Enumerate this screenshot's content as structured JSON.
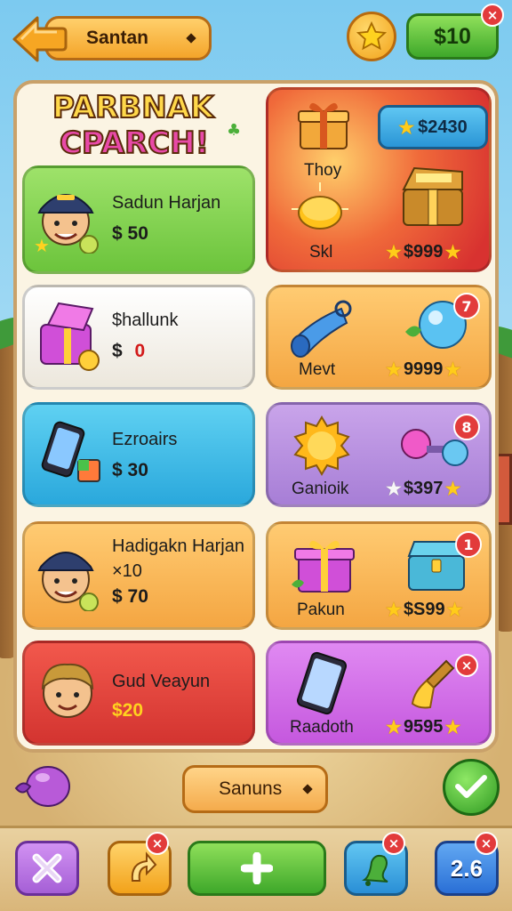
{
  "header": {
    "title": "Santan",
    "cash": "$10",
    "cash_badge": "×"
  },
  "logo": {
    "line1": "PARBNAK",
    "line2": "CPARCH!"
  },
  "players": [
    {
      "name": "Sadun Harjan",
      "price": "$ 50"
    },
    {
      "name": "$hallunk",
      "price": "$ 0",
      "price_prefix": "$",
      "price_value": "0"
    },
    {
      "name": "Ezroairs",
      "price": "$ 30"
    },
    {
      "name": "Hadigakn Harjan",
      "sub": "×10",
      "price": "$ 70"
    },
    {
      "name": "Gud Veayun",
      "price": "$20"
    }
  ],
  "featured": {
    "balance": "$2430",
    "label_top": "Thoy",
    "label_bottom": "Skl",
    "price": "$999"
  },
  "items": [
    {
      "label": "Mevt",
      "price": "9999",
      "badge": "7"
    },
    {
      "label": "Ganioik",
      "price": "$397",
      "badge": "8"
    },
    {
      "label": "Pakun",
      "price": "$S99",
      "badge": "1"
    },
    {
      "label": "Raadoth",
      "price": "9595",
      "badge": "×"
    }
  ],
  "bottom": {
    "center_button": "Sanuns",
    "level": "2.6",
    "arrow_badge": "×",
    "bell_badge": "×",
    "level_badge": "×"
  },
  "colors": {
    "accent_orange": "#f4a52a",
    "accent_green": "#3ea82a",
    "badge_red": "#e23b3b",
    "panel": "#fbf4e3"
  }
}
